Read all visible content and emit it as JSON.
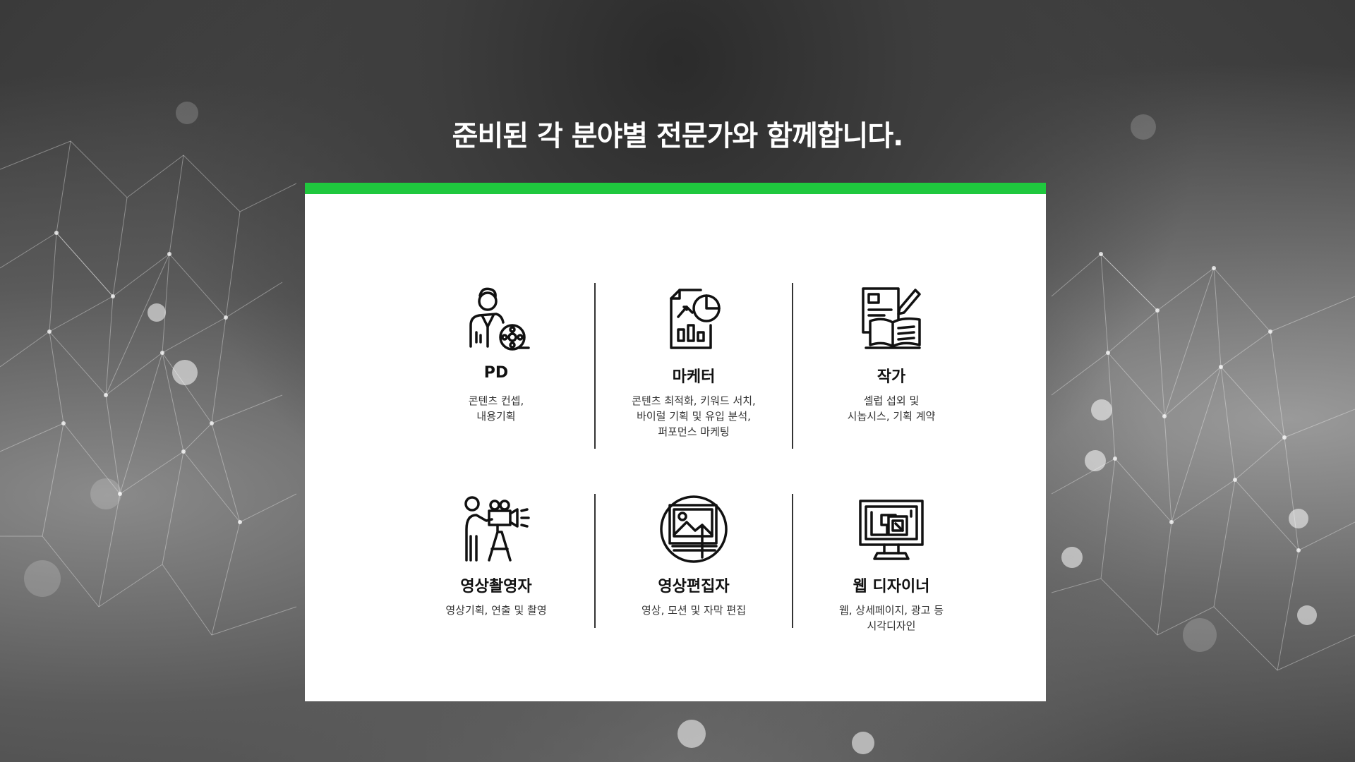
{
  "headline": "준비된 각 분야별 전문가와 함께합니다.",
  "colors": {
    "accent": "#1fc83e",
    "panel": "#ffffff",
    "text": "#111111"
  },
  "experts": [
    {
      "icon": "producer-film-reel-icon",
      "title": "PD",
      "description": "콘텐츠 컨셉,\n내용기획"
    },
    {
      "icon": "marketing-report-chart-icon",
      "title": "마케터",
      "description": "콘텐츠 최적화, 키워드 서치,\n바이럴 기획 및 유입 분석,\n퍼포먼스 마케팅"
    },
    {
      "icon": "writer-book-pen-icon",
      "title": "작가",
      "description": "셀럽 섭외 및\n시놉시스, 기획 계약"
    },
    {
      "icon": "cameraman-tripod-icon",
      "title": "영상촬영자",
      "description": "영상기획, 연출 및 촬영"
    },
    {
      "icon": "video-editor-image-frame-icon",
      "title": "영상편집자",
      "description": "영상, 모션 및 자막 편집"
    },
    {
      "icon": "web-designer-monitor-icon",
      "title": "웹 디자이너",
      "description": "웹, 상세페이지, 광고 등\n시각디자인"
    }
  ]
}
